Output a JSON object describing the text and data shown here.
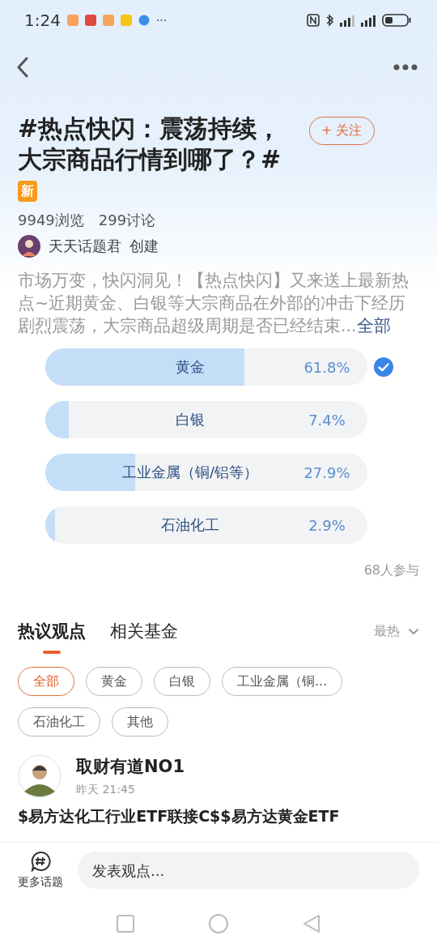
{
  "status_bar": {
    "time": "1:24",
    "more": "···"
  },
  "topic": {
    "title": "#热点快闪：震荡持续，大宗商品行情到哪了？#",
    "badge": "新",
    "follow_button": "+ 关注",
    "views": "9949浏览",
    "discussions": "299讨论",
    "creator": "天天话题君",
    "creator_action": "创建",
    "description": "市场万变，快闪洞见！【热点快闪】又来送上最新热点~近期黄金、白银等大宗商品在外部的冲击下经历剧烈震荡，大宗商品超级周期是否已经结束...",
    "more_link": "全部"
  },
  "poll": {
    "options": [
      {
        "label": "黄金",
        "percent": "61.8%",
        "level": 0.618,
        "selected": true
      },
      {
        "label": "白银",
        "percent": "7.4%",
        "level": 0.074,
        "selected": false
      },
      {
        "label": "工业金属（铜/铝等）",
        "percent": "27.9%",
        "level": 0.279,
        "selected": false
      },
      {
        "label": "石油化工",
        "percent": "2.9%",
        "level": 0.029,
        "selected": false
      }
    ],
    "participants": "68人参与"
  },
  "tabs": [
    {
      "label": "热议观点",
      "selected": true
    },
    {
      "label": "相关基金",
      "selected": false
    }
  ],
  "sort": "最热",
  "filters": [
    {
      "label": "全部",
      "selected": true
    },
    {
      "label": "黄金",
      "selected": false
    },
    {
      "label": "白银",
      "selected": false
    },
    {
      "label": "工业金属（铜...",
      "selected": false
    },
    {
      "label": "石油化工",
      "selected": false
    },
    {
      "label": "其他",
      "selected": false
    }
  ],
  "post": {
    "author": "取财有道NO1",
    "time": "昨天 21:45",
    "text": "$易方达化工行业ETF联接C$$易方达黄金ETF"
  },
  "bottom_bar": {
    "more_topics": "更多话题",
    "comment_placeholder": "发表观点..."
  }
}
